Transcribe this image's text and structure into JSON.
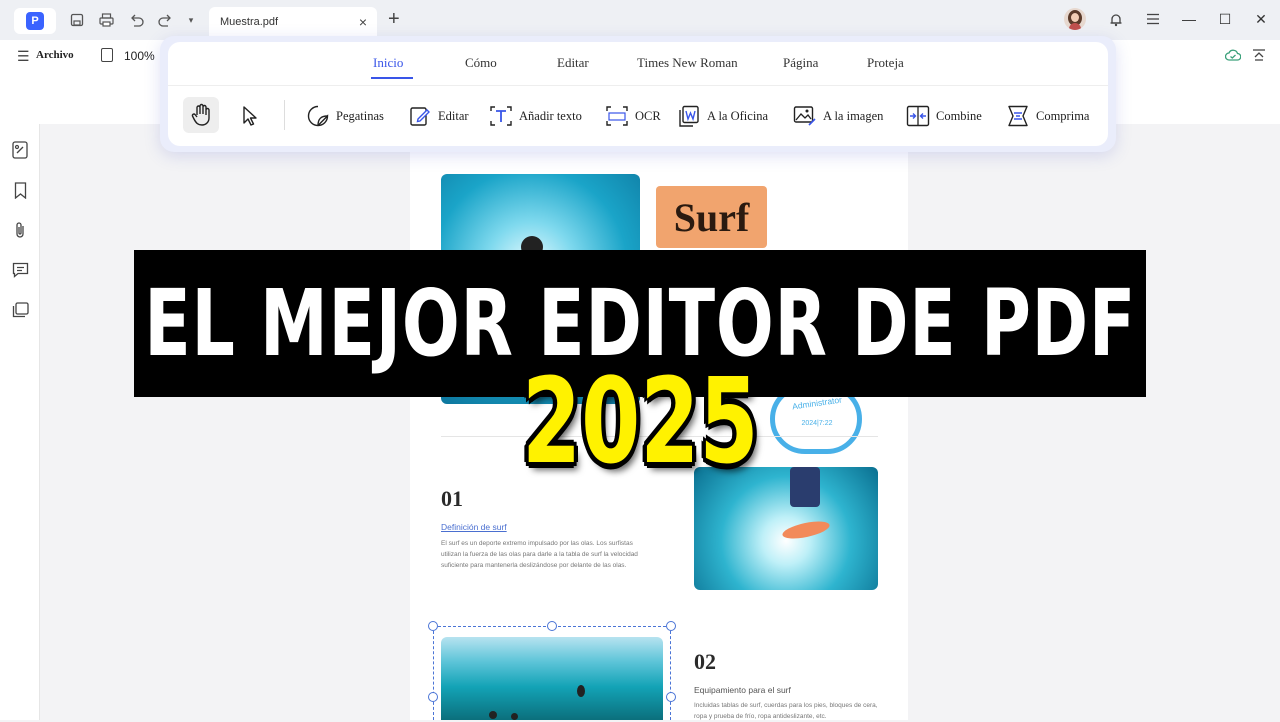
{
  "titlebar": {
    "tab_label": "Muestra.pdf",
    "tab_close": "×",
    "new_tab": "+",
    "min": "—",
    "max": "☐",
    "close": "✕",
    "dropdown": "▾"
  },
  "menubar": {
    "menu_glyph": "☰",
    "menu_label": "Archivo",
    "zoom": "100%"
  },
  "ribbon": {
    "tabs": [
      "Inicio",
      "Cómo",
      "Editar",
      "Times New Roman",
      "Página",
      "Proteja"
    ],
    "active_tab": "Inicio",
    "tools": [
      "Pegatinas",
      "Editar",
      "Añadir texto",
      "OCR",
      "A la Oficina",
      "A la imagen",
      "Combine",
      "Comprima"
    ]
  },
  "document": {
    "badge": "Surf",
    "stamp_label": "Administrator",
    "stamp_date": "2024|7:22",
    "section1": {
      "num": "01",
      "title": "Definición de surf",
      "body_line1": "El surf es un deporte extremo impulsado por las olas. Los surfistas",
      "body_line2": "utilizan la fuerza de las olas para darle a la tabla de surf la velocidad",
      "body_line3": "suficiente para mantenerla deslizándose por delante de las olas."
    },
    "section2": {
      "num": "02",
      "title": "Equipamiento para el surf",
      "body_line1": "Incluidas tablas de surf, cuerdas para los pies, bloques de cera,",
      "body_line2": "ropa y prueba de frío, ropa antideslizante, etc."
    }
  },
  "overlay": {
    "headline": "EL MEJOR EDITOR DE PDF",
    "year": "2025"
  },
  "colors": {
    "accent": "#3955e8",
    "banner_bg": "#000000",
    "year_text": "#fff200",
    "badge_bg": "#f1a46e",
    "stamp": "#48b0e8"
  }
}
